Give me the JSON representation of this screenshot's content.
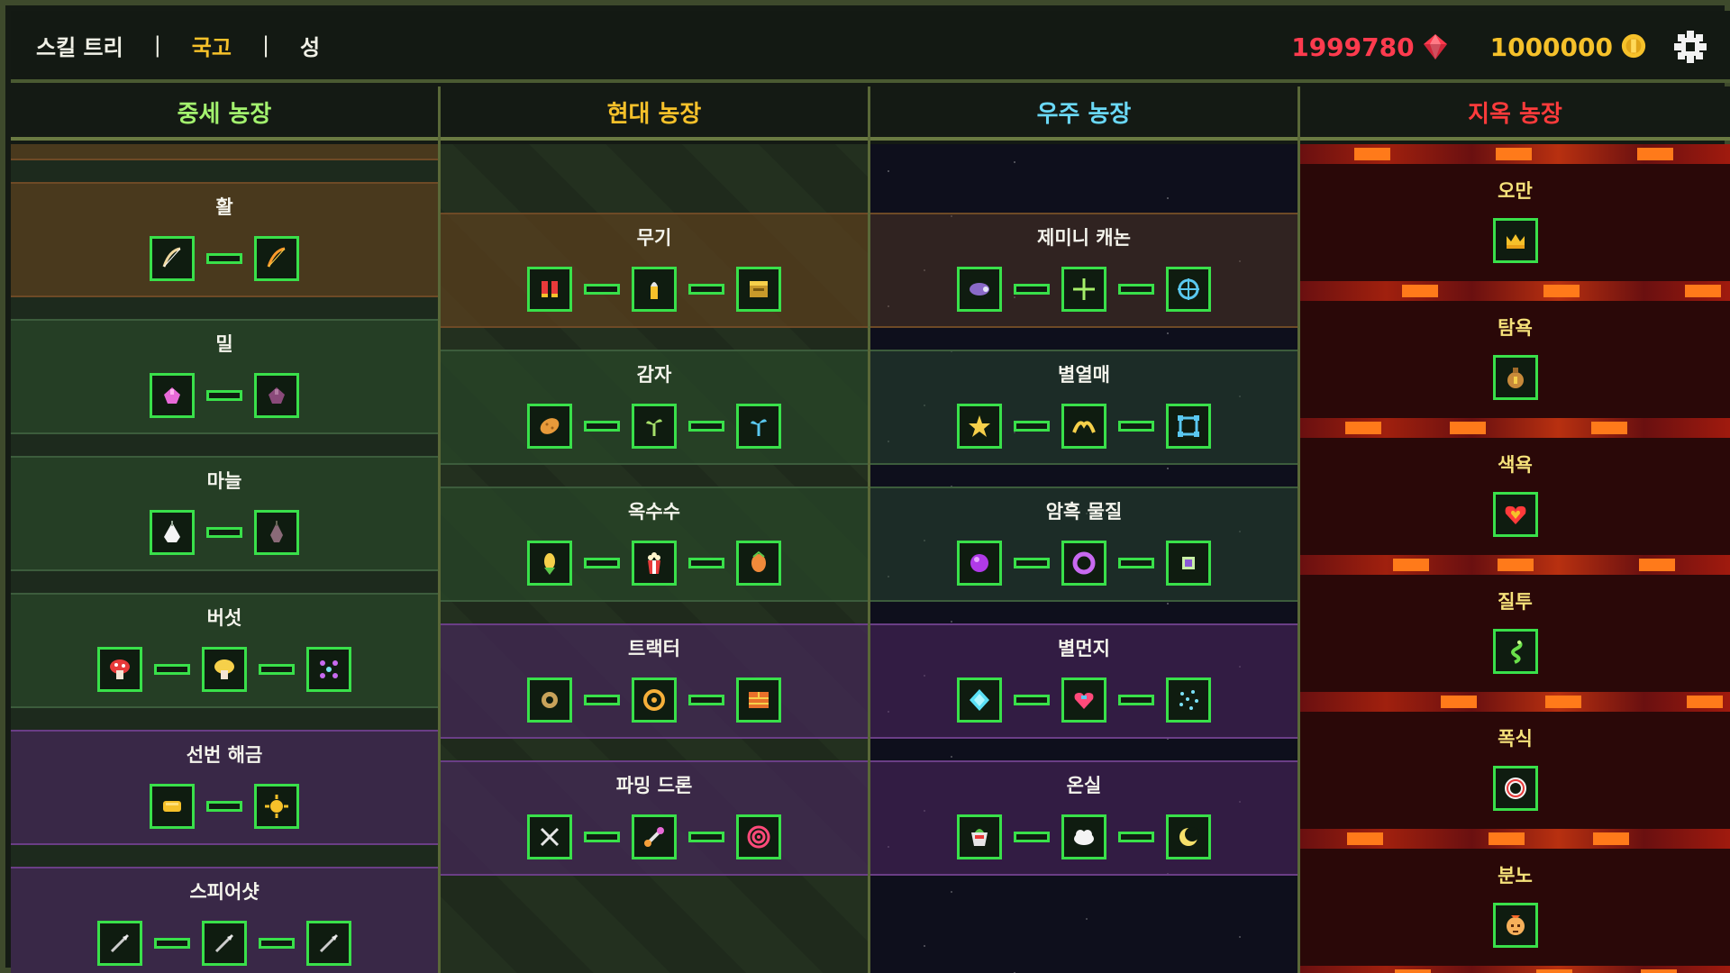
{
  "nav": {
    "tabs": [
      "스킬 트리",
      "국고",
      "성"
    ],
    "active": 1,
    "separator": "|"
  },
  "currency": {
    "gems": "1999780",
    "coins": "1000000"
  },
  "colors": {
    "node_border": "#39e04a",
    "gem": "#ff3b4e",
    "coin": "#f6c12a",
    "active_tab": "#f6c12a"
  },
  "columns": [
    {
      "key": "medieval",
      "title": "중세 농장",
      "rows": [
        {
          "title": "",
          "tone": "orange",
          "icons": [
            "red-feather-icon",
            "white-feather-icon"
          ]
        },
        {
          "title": "활",
          "tone": "orange",
          "icons": [
            "bow-icon",
            "flame-bow-icon"
          ]
        },
        {
          "title": "밀",
          "tone": "green",
          "icons": [
            "pink-wheat-icon",
            "dark-wheat-icon"
          ]
        },
        {
          "title": "마늘",
          "tone": "green",
          "icons": [
            "garlic-icon",
            "dark-garlic-icon"
          ]
        },
        {
          "title": "버섯",
          "tone": "green",
          "icons": [
            "red-mushroom-icon",
            "yellow-mushroom-icon",
            "purple-spores-icon"
          ]
        },
        {
          "title": "선번 해금",
          "tone": "purple",
          "icons": [
            "gold-bar-icon",
            "gold-sun-icon"
          ]
        },
        {
          "title": "스피어샷",
          "tone": "purple",
          "icons": [
            "spear-icon",
            "spear-icon",
            "spear-icon"
          ]
        }
      ]
    },
    {
      "key": "modern",
      "title": "현대 농장",
      "rows": [
        {
          "title": "무기",
          "tone": "orange",
          "icons": [
            "shells-icon",
            "bullet-icon",
            "ammo-box-icon"
          ]
        },
        {
          "title": "감자",
          "tone": "green",
          "icons": [
            "potato-icon",
            "sprout-icon",
            "blue-sprout-icon"
          ]
        },
        {
          "title": "옥수수",
          "tone": "green",
          "icons": [
            "corn-icon",
            "popcorn-icon",
            "corn-cob-icon"
          ]
        },
        {
          "title": "트랙터",
          "tone": "purple",
          "icons": [
            "gear-icon",
            "wheel-icon",
            "brick-icon"
          ]
        },
        {
          "title": "파밍 드론",
          "tone": "purple",
          "icons": [
            "drone-icon",
            "drone-arm-icon",
            "target-icon"
          ]
        }
      ]
    },
    {
      "key": "space",
      "title": "우주 농장",
      "rows": [
        {
          "title": "제미니 캐논",
          "tone": "orange",
          "icons": [
            "cannon-icon",
            "crosshair-icon",
            "target-ring-icon"
          ]
        },
        {
          "title": "별열매",
          "tone": "green",
          "icons": [
            "star-fruit-icon",
            "star-pair-icon",
            "star-frame-icon"
          ]
        },
        {
          "title": "암흑 물질",
          "tone": "green",
          "icons": [
            "dark-orb-icon",
            "dark-ring-icon",
            "dark-cube-icon"
          ]
        },
        {
          "title": "별먼지",
          "tone": "purple",
          "icons": [
            "diamond-star-icon",
            "heart-gem-icon",
            "stardust-icon"
          ]
        },
        {
          "title": "온실",
          "tone": "purple",
          "icons": [
            "pot-icon",
            "cloud-icon",
            "moon-icon"
          ]
        }
      ]
    },
    {
      "key": "hell",
      "title": "지옥 농장",
      "rows": [
        {
          "title": "오만",
          "icons": [
            "crown-icon"
          ]
        },
        {
          "title": "탐욕",
          "icons": [
            "money-bag-icon"
          ]
        },
        {
          "title": "색욕",
          "icons": [
            "heart-icon"
          ]
        },
        {
          "title": "질투",
          "icons": [
            "snake-icon"
          ]
        },
        {
          "title": "폭식",
          "icons": [
            "ring-donut-icon"
          ]
        },
        {
          "title": "분노",
          "icons": [
            "angry-face-icon"
          ]
        }
      ]
    }
  ]
}
